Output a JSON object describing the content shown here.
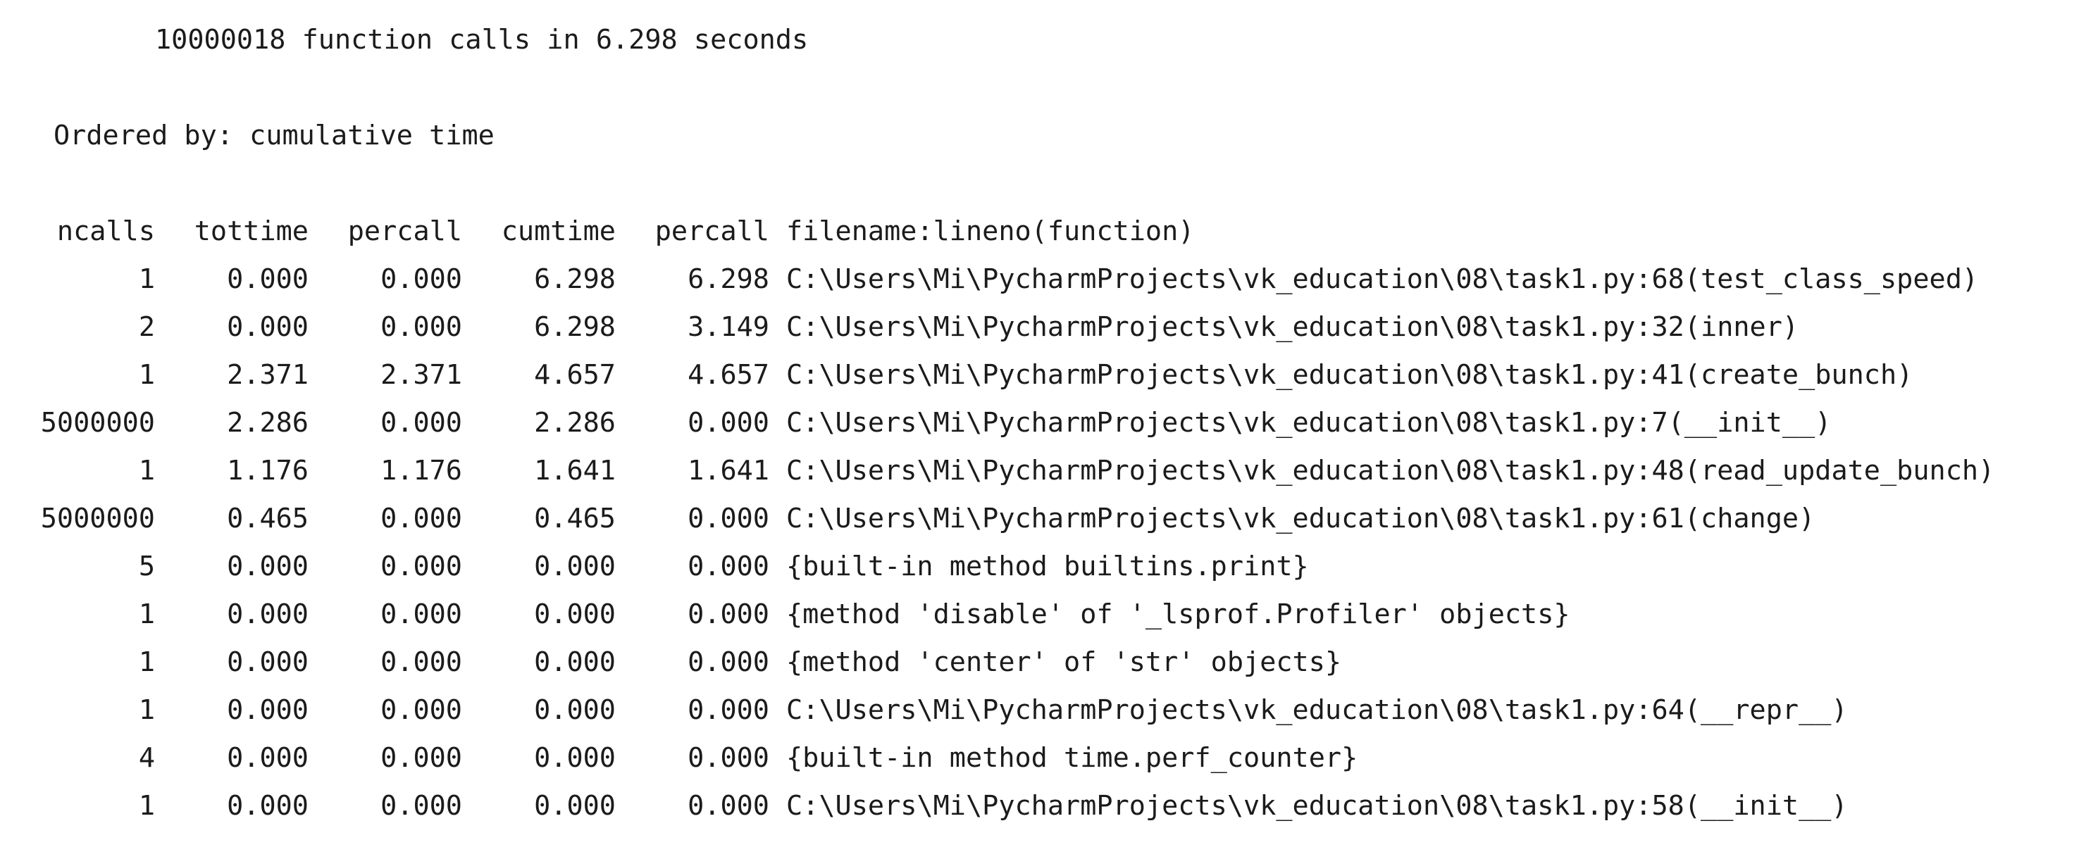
{
  "summary": "10000018 function calls in 6.298 seconds",
  "ordered_by": "Ordered by: cumulative time",
  "columns": {
    "ncalls": "ncalls",
    "tottime": "tottime",
    "percall1": "percall",
    "cumtime": "cumtime",
    "percall2": "percall",
    "func": "filename:lineno(function)"
  },
  "rows": [
    {
      "ncalls": "1",
      "tottime": "0.000",
      "percall1": "0.000",
      "cumtime": "6.298",
      "percall2": "6.298",
      "func": "C:\\Users\\Mi\\PycharmProjects\\vk_education\\08\\task1.py:68(test_class_speed)"
    },
    {
      "ncalls": "2",
      "tottime": "0.000",
      "percall1": "0.000",
      "cumtime": "6.298",
      "percall2": "3.149",
      "func": "C:\\Users\\Mi\\PycharmProjects\\vk_education\\08\\task1.py:32(inner)"
    },
    {
      "ncalls": "1",
      "tottime": "2.371",
      "percall1": "2.371",
      "cumtime": "4.657",
      "percall2": "4.657",
      "func": "C:\\Users\\Mi\\PycharmProjects\\vk_education\\08\\task1.py:41(create_bunch)"
    },
    {
      "ncalls": "5000000",
      "tottime": "2.286",
      "percall1": "0.000",
      "cumtime": "2.286",
      "percall2": "0.000",
      "func": "C:\\Users\\Mi\\PycharmProjects\\vk_education\\08\\task1.py:7(__init__)"
    },
    {
      "ncalls": "1",
      "tottime": "1.176",
      "percall1": "1.176",
      "cumtime": "1.641",
      "percall2": "1.641",
      "func": "C:\\Users\\Mi\\PycharmProjects\\vk_education\\08\\task1.py:48(read_update_bunch)"
    },
    {
      "ncalls": "5000000",
      "tottime": "0.465",
      "percall1": "0.000",
      "cumtime": "0.465",
      "percall2": "0.000",
      "func": "C:\\Users\\Mi\\PycharmProjects\\vk_education\\08\\task1.py:61(change)"
    },
    {
      "ncalls": "5",
      "tottime": "0.000",
      "percall1": "0.000",
      "cumtime": "0.000",
      "percall2": "0.000",
      "func": "{built-in method builtins.print}"
    },
    {
      "ncalls": "1",
      "tottime": "0.000",
      "percall1": "0.000",
      "cumtime": "0.000",
      "percall2": "0.000",
      "func": "{method 'disable' of '_lsprof.Profiler' objects}"
    },
    {
      "ncalls": "1",
      "tottime": "0.000",
      "percall1": "0.000",
      "cumtime": "0.000",
      "percall2": "0.000",
      "func": "{method 'center' of 'str' objects}"
    },
    {
      "ncalls": "1",
      "tottime": "0.000",
      "percall1": "0.000",
      "cumtime": "0.000",
      "percall2": "0.000",
      "func": "C:\\Users\\Mi\\PycharmProjects\\vk_education\\08\\task1.py:64(__repr__)"
    },
    {
      "ncalls": "4",
      "tottime": "0.000",
      "percall1": "0.000",
      "cumtime": "0.000",
      "percall2": "0.000",
      "func": "{built-in method time.perf_counter}"
    },
    {
      "ncalls": "1",
      "tottime": "0.000",
      "percall1": "0.000",
      "cumtime": "0.000",
      "percall2": "0.000",
      "func": "C:\\Users\\Mi\\PycharmProjects\\vk_education\\08\\task1.py:58(__init__)"
    }
  ]
}
